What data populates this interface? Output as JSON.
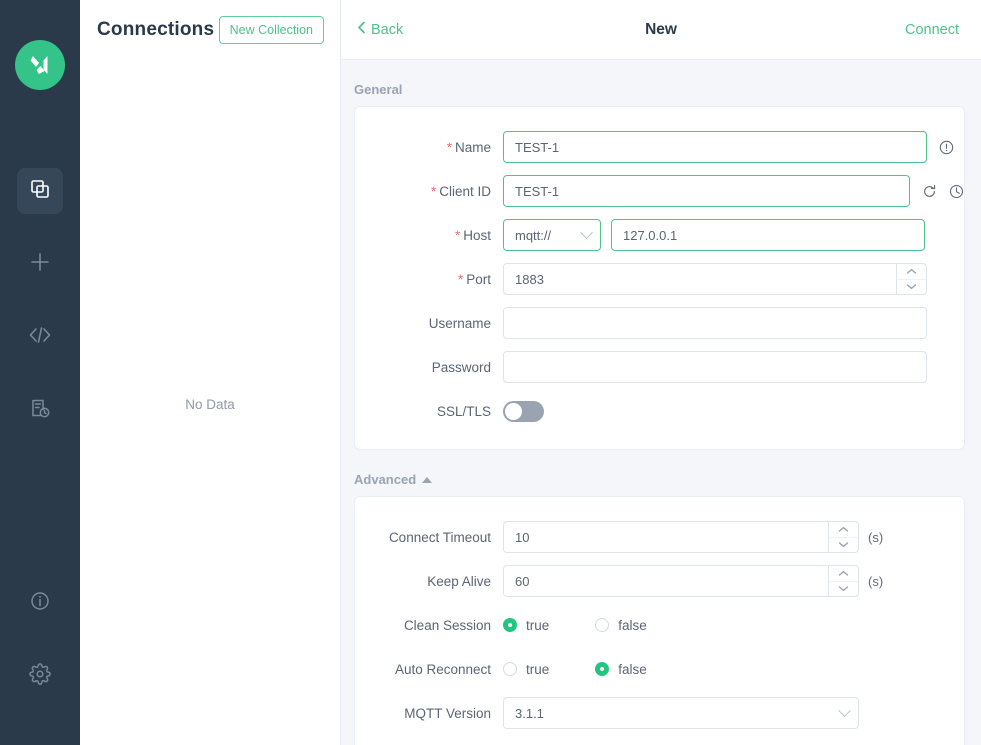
{
  "app": {
    "logo_icon": "mqttx-logo-icon",
    "accent_color": "#4cc38a",
    "rail_bg": "#2b3a4a",
    "required_color": "#f56c6c"
  },
  "rail": {
    "items": [
      {
        "name": "connections",
        "icon": "copy-stack-icon",
        "active": true
      },
      {
        "name": "new-connection",
        "icon": "plus-icon",
        "active": false
      },
      {
        "name": "scripts",
        "icon": "code-brackets-icon",
        "active": false
      },
      {
        "name": "log",
        "icon": "document-clock-icon",
        "active": false
      }
    ],
    "bottom_items": [
      {
        "name": "about",
        "icon": "info-circle-icon"
      },
      {
        "name": "settings",
        "icon": "gear-icon"
      }
    ]
  },
  "connections": {
    "title": "Connections",
    "new_collection_label": "New Collection",
    "empty_text": "No Data"
  },
  "header": {
    "back_label": "Back",
    "title": "New",
    "connect_label": "Connect",
    "back_icon": "chevron-left-icon"
  },
  "general": {
    "section_label": "General",
    "fields": {
      "name": {
        "label": "Name",
        "required": true,
        "value": "TEST-1",
        "placeholder": "",
        "icon": "exclamation-circle-icon"
      },
      "client_id": {
        "label": "Client ID",
        "required": true,
        "value": "TEST-1",
        "placeholder": "",
        "icons": [
          "refresh-icon",
          "clock-icon"
        ]
      },
      "host": {
        "label": "Host",
        "required": true,
        "protocol": "mqtt://",
        "value": "127.0.0.1",
        "placeholder": "",
        "dropdown_icon": "chevron-down-icon"
      },
      "port": {
        "label": "Port",
        "required": true,
        "value": "1883",
        "stepper_up_icon": "chevron-up-icon",
        "stepper_down_icon": "chevron-down-icon"
      },
      "username": {
        "label": "Username",
        "required": false,
        "value": "",
        "placeholder": ""
      },
      "password": {
        "label": "Password",
        "required": false,
        "value": "",
        "placeholder": ""
      },
      "ssl_tls": {
        "label": "SSL/TLS",
        "enabled": false
      }
    }
  },
  "advanced": {
    "section_label": "Advanced",
    "collapse_icon": "caret-up-icon",
    "fields": {
      "connect_timeout": {
        "label": "Connect Timeout",
        "value": "10",
        "unit": "(s)"
      },
      "keep_alive": {
        "label": "Keep Alive",
        "value": "60",
        "unit": "(s)"
      },
      "clean_session": {
        "label": "Clean Session",
        "options": [
          "true",
          "false"
        ],
        "selected": "true"
      },
      "auto_reconnect": {
        "label": "Auto Reconnect",
        "options": [
          "true",
          "false"
        ],
        "selected": "false"
      },
      "mqtt_version": {
        "label": "MQTT Version",
        "value": "3.1.1",
        "dropdown_icon": "chevron-down-icon"
      }
    }
  }
}
